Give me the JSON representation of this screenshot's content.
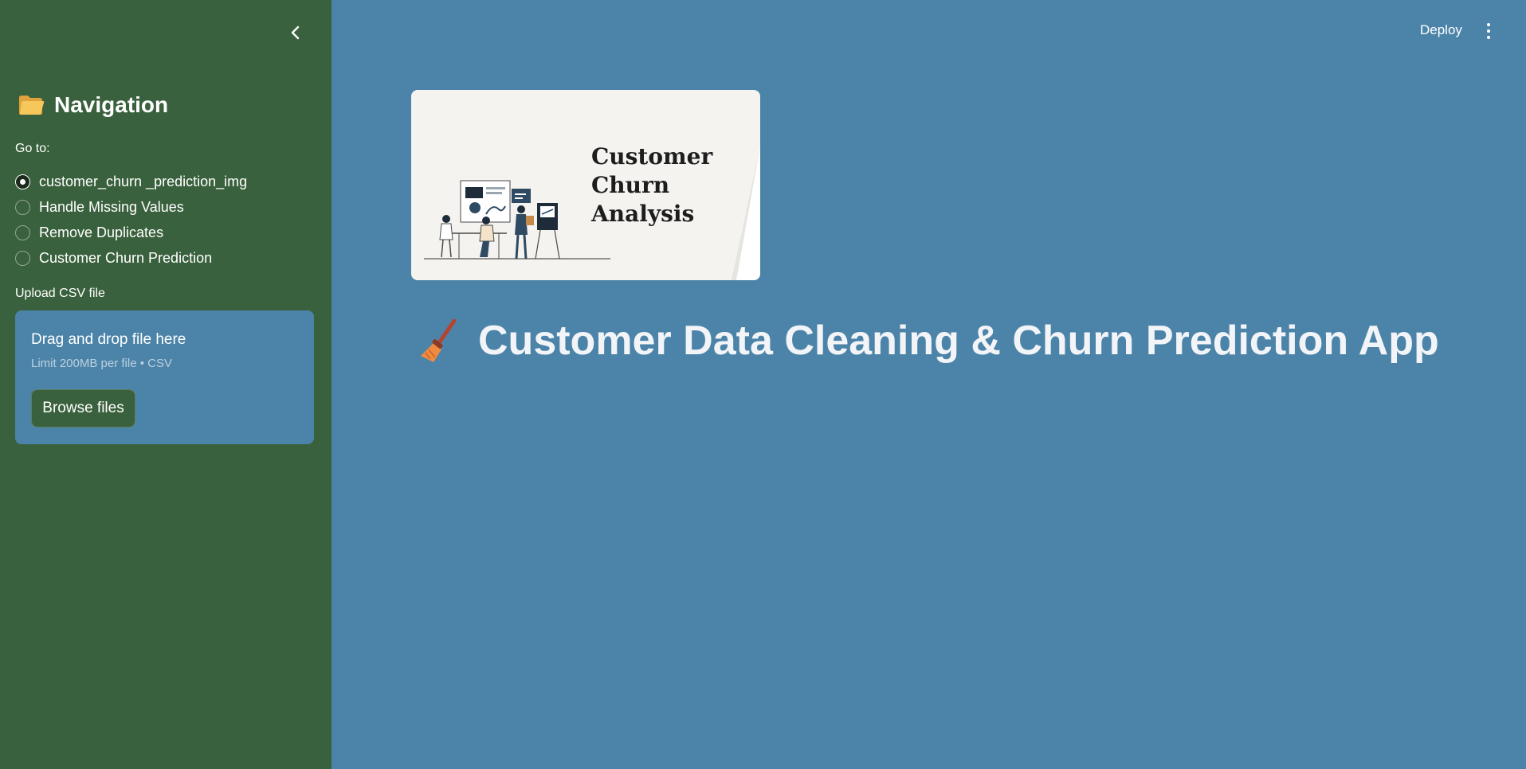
{
  "sidebar": {
    "heading": "Navigation",
    "heading_icon": "folder-icon",
    "goto_label": "Go to:",
    "options": [
      {
        "label": "customer_churn _prediction_img",
        "checked": true
      },
      {
        "label": "Handle Missing Values",
        "checked": false
      },
      {
        "label": "Remove Duplicates",
        "checked": false
      },
      {
        "label": "Customer Churn Prediction",
        "checked": false
      }
    ],
    "upload": {
      "label": "Upload CSV file",
      "drop_title": "Drag and drop file here",
      "drop_subtitle": "Limit 200MB per file • CSV",
      "browse_label": "Browse files"
    }
  },
  "header": {
    "deploy_label": "Deploy",
    "menu_icon": "kebab-menu-icon",
    "collapse_icon": "chevron-left-icon"
  },
  "main": {
    "banner": {
      "line1": "Customer",
      "line2": "Churn",
      "line3": "Analysis"
    },
    "title_icon": "broom-icon",
    "title": "Customer Data Cleaning & Churn Prediction App"
  },
  "colors": {
    "sidebar_bg": "#3a613d",
    "main_bg": "#4c84a9",
    "banner_bg": "#f4f3ef",
    "title_text": "#f2f4f7"
  }
}
